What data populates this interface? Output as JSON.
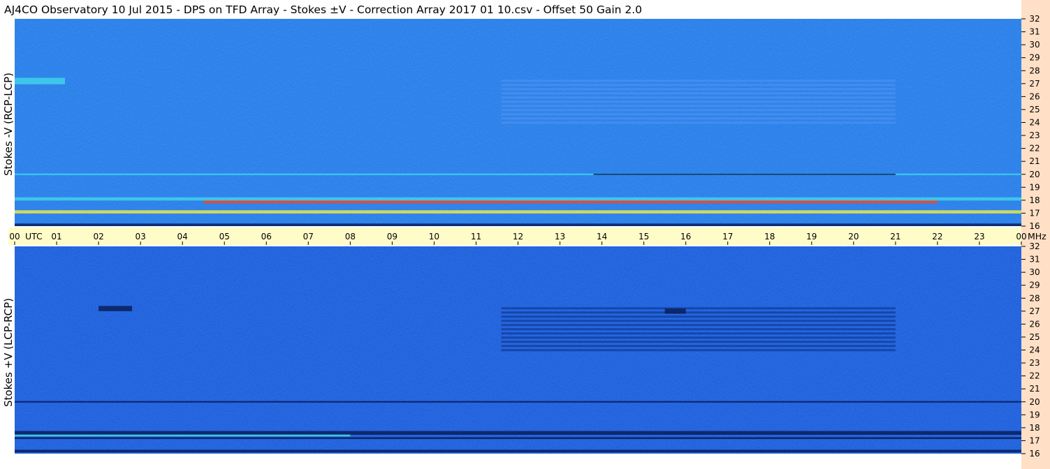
{
  "chart_data": {
    "type": "heatmap",
    "title": "AJ4CO Observatory  10 Jul 2015  -  DPS on TFD Array  -  Stokes ±V  -  Correction Array 2017 01 10.csv  -  Offset 50  Gain 2.0",
    "xlabel": "UTC",
    "x_unit_label": "MHz",
    "x_tick_labels": [
      "00",
      "01",
      "02",
      "03",
      "04",
      "05",
      "06",
      "07",
      "08",
      "09",
      "10",
      "11",
      "12",
      "13",
      "14",
      "15",
      "16",
      "17",
      "18",
      "19",
      "20",
      "21",
      "22",
      "23",
      "00"
    ],
    "xlim_hours": [
      0,
      24
    ],
    "colors": {
      "background_blue": "#1f6fe6",
      "time_strip": "#fffcc8",
      "freq_strip": "#ffe0c6",
      "band_cyan": "#3fd2ea",
      "band_yellow": "#e8e84a",
      "band_red": "#e64a3a",
      "band_dark": "#0a1e5a"
    },
    "panels": [
      {
        "name": "Stokes -V (RCP-LCP)",
        "ylabel": "Stokes -V (RCP-LCP)",
        "ylim_mhz": [
          16,
          32
        ],
        "y_tick_labels": [
          "32",
          "31",
          "30",
          "29",
          "28",
          "27",
          "26",
          "25",
          "24",
          "23",
          "22",
          "21",
          "20",
          "19",
          "18",
          "17",
          "16"
        ],
        "base_color": "#2a7de8",
        "features": [
          {
            "kind": "band",
            "freq_mhz": 17.1,
            "width_mhz": 0.25,
            "start_utc": 0.0,
            "end_utc": 24.0,
            "color": "#e8e84a"
          },
          {
            "kind": "band",
            "freq_mhz": 17.9,
            "width_mhz": 0.3,
            "start_utc": 4.5,
            "end_utc": 22.0,
            "color": "#e64a3a"
          },
          {
            "kind": "band",
            "freq_mhz": 18.1,
            "width_mhz": 0.25,
            "start_utc": 0.0,
            "end_utc": 24.0,
            "color": "#3fd2ea"
          },
          {
            "kind": "band",
            "freq_mhz": 20.0,
            "width_mhz": 0.12,
            "start_utc": 0.0,
            "end_utc": 24.0,
            "color": "#3fd2ea"
          },
          {
            "kind": "band",
            "freq_mhz": 16.1,
            "width_mhz": 0.2,
            "start_utc": 0.0,
            "end_utc": 24.0,
            "color": "#0a1e5a"
          },
          {
            "kind": "band",
            "freq_mhz": 20.0,
            "width_mhz": 0.1,
            "start_utc": 13.8,
            "end_utc": 21.0,
            "color": "#0a1e5a"
          },
          {
            "kind": "stripes",
            "freq_from_mhz": 24.0,
            "freq_to_mhz": 27.3,
            "start_utc": 11.6,
            "end_utc": 21.0,
            "color": "#4a8ff0"
          },
          {
            "kind": "band",
            "freq_mhz": 27.2,
            "width_mhz": 0.5,
            "start_utc": 0.0,
            "end_utc": 1.2,
            "color": "#3fd2ea"
          }
        ]
      },
      {
        "name": "Stokes +V (LCP-RCP)",
        "ylabel": "Stokes +V (LCP-RCP)",
        "ylim_mhz": [
          16,
          32
        ],
        "y_tick_labels": [
          "32",
          "31",
          "30",
          "29",
          "28",
          "27",
          "26",
          "25",
          "24",
          "23",
          "22",
          "21",
          "20",
          "19",
          "18",
          "17",
          "16"
        ],
        "base_color": "#1f5fdc",
        "features": [
          {
            "kind": "band",
            "freq_mhz": 17.6,
            "width_mhz": 0.3,
            "start_utc": 0.0,
            "end_utc": 24.0,
            "color": "#0a1e5a"
          },
          {
            "kind": "band",
            "freq_mhz": 17.2,
            "width_mhz": 0.15,
            "start_utc": 0.0,
            "end_utc": 24.0,
            "color": "#0a1e5a"
          },
          {
            "kind": "band",
            "freq_mhz": 17.4,
            "width_mhz": 0.15,
            "start_utc": 0.0,
            "end_utc": 8.0,
            "color": "#3fd2ea"
          },
          {
            "kind": "band",
            "freq_mhz": 20.0,
            "width_mhz": 0.12,
            "start_utc": 0.0,
            "end_utc": 24.0,
            "color": "#0a1e5a"
          },
          {
            "kind": "band",
            "freq_mhz": 16.2,
            "width_mhz": 0.2,
            "start_utc": 0.0,
            "end_utc": 24.0,
            "color": "#0a1e5a"
          },
          {
            "kind": "stripes",
            "freq_from_mhz": 24.0,
            "freq_to_mhz": 27.3,
            "start_utc": 11.6,
            "end_utc": 21.0,
            "color": "#123f9c"
          },
          {
            "kind": "band",
            "freq_mhz": 27.0,
            "width_mhz": 0.4,
            "start_utc": 15.5,
            "end_utc": 16.0,
            "color": "#0a1e5a"
          },
          {
            "kind": "band",
            "freq_mhz": 27.2,
            "width_mhz": 0.4,
            "start_utc": 2.0,
            "end_utc": 2.8,
            "color": "#0a1e5a"
          }
        ]
      }
    ]
  }
}
